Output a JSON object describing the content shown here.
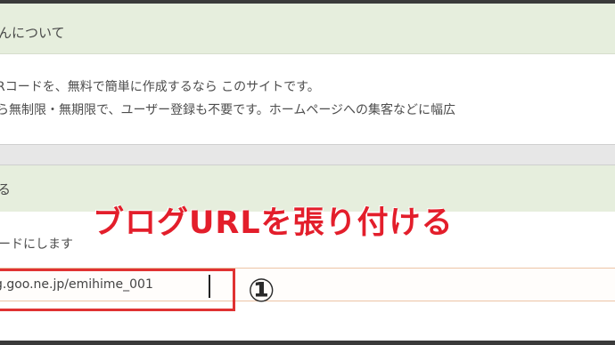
{
  "sections": [
    {
      "title": "んについて",
      "lines": [
        "Rコードを、無料で簡単に作成するなら このサイトです。",
        "ら無制限・無期限で、ユーザー登録も不要です。ホームページへの集客などに幅広"
      ]
    },
    {
      "title": "る",
      "field_label": "ードにします",
      "url_value": "g.goo.ne.jp/emihime_001"
    }
  ],
  "annotation": "ブログURLを張り付ける",
  "step_marker": "①"
}
